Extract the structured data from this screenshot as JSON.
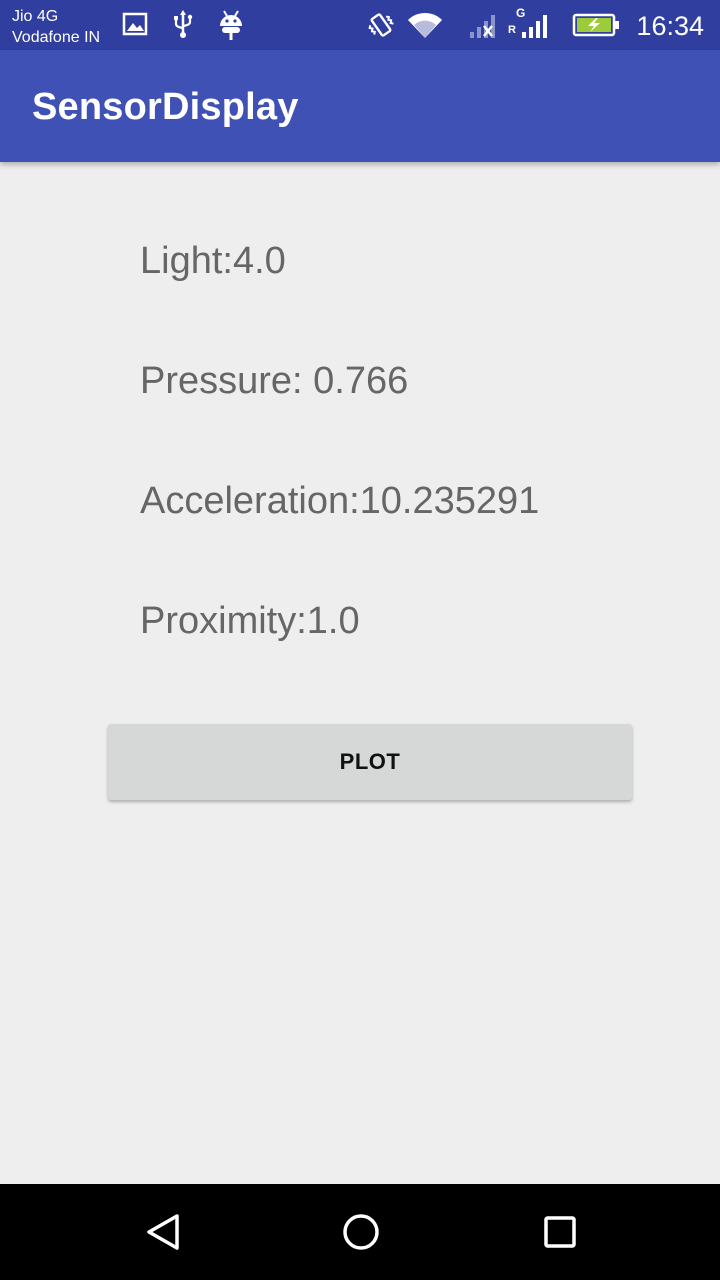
{
  "status_bar": {
    "carrier_1": "Jio 4G",
    "carrier_2": "Vodafone IN",
    "network_type": "G",
    "roaming": "R",
    "time": "16:34",
    "icons": [
      "gallery-icon",
      "usb-icon",
      "android-icon",
      "vibrate-icon",
      "wifi-icon",
      "signal-sim1-icon",
      "signal-sim2-icon",
      "battery-charging-icon"
    ]
  },
  "app_bar": {
    "title": "SensorDisplay",
    "color": "#3f51b5"
  },
  "sensors": {
    "light": "Light:4.0",
    "pressure": "Pressure: 0.766",
    "acceleration": "Acceleration:10.235291",
    "proximity": "Proximity:1.0"
  },
  "plot_button": {
    "label": "PLOT"
  },
  "nav_bar": {
    "buttons": [
      "back-icon",
      "home-icon",
      "recents-icon"
    ]
  },
  "colors": {
    "status_bar": "#303f9f",
    "primary": "#3f51b5",
    "background": "#eeeeee",
    "text_secondary": "#666666",
    "button": "#d6d7d7",
    "battery": "#9ccc3c"
  }
}
